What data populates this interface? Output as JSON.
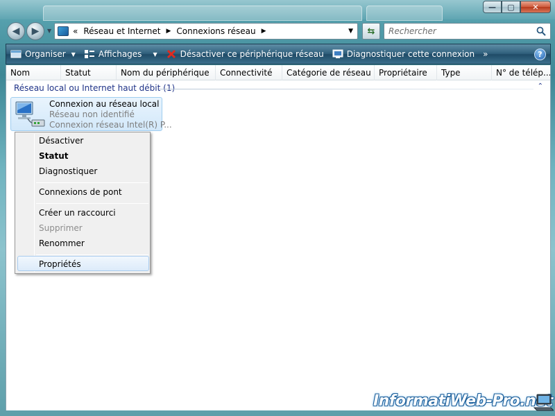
{
  "window": {
    "controls": {
      "minimize": "—",
      "maximize": "▢",
      "close": "✕"
    }
  },
  "nav": {
    "back_icon": "back-arrow-icon",
    "forward_icon": "forward-arrow-icon"
  },
  "address": {
    "overflow": "«",
    "crumbs": [
      "Réseau et Internet",
      "Connexions réseau"
    ]
  },
  "search": {
    "placeholder": "Rechercher"
  },
  "commands": {
    "organize": "Organiser",
    "views": "Affichages",
    "disable": "Désactiver ce périphérique réseau",
    "diagnose": "Diagnostiquer cette connexion",
    "more": "»",
    "help": "?"
  },
  "columns": [
    "Nom",
    "Statut",
    "Nom du périphérique",
    "Connectivité",
    "Catégorie de réseau",
    "Propriétaire",
    "Type",
    "N° de télép..."
  ],
  "group": {
    "label": "Réseau local ou Internet haut débit (1)",
    "collapse": "⌃"
  },
  "connection": {
    "name": "Connexion au réseau local",
    "status": "Réseau non identifié",
    "device": "Connexion réseau Intel(R) P..."
  },
  "context_menu": {
    "disable": "Désactiver",
    "status": "Statut",
    "diagnose": "Diagnostiquer",
    "bridge": "Connexions de pont",
    "shortcut": "Créer un raccourci",
    "delete": "Supprimer",
    "rename": "Renommer",
    "properties": "Propriétés"
  },
  "watermark": "InformatiWeb-Pro.net",
  "colors": {
    "cmdbar": "#2f5f7c",
    "group_text": "#1e3287",
    "selection": "#d2e8fa",
    "disabled_text": "#8d8d8d"
  }
}
